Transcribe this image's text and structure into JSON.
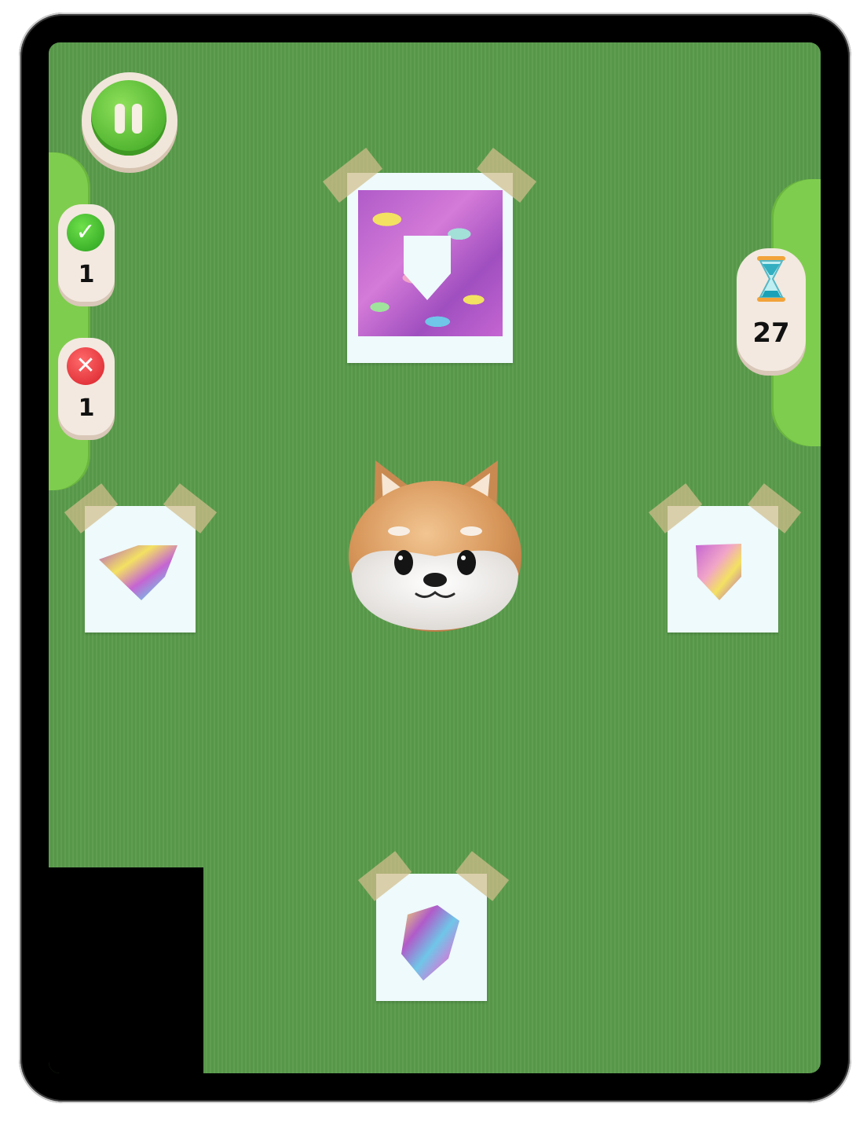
{
  "hud": {
    "correct_count": "1",
    "wrong_count": "1",
    "timer_value": "27"
  },
  "icons": {
    "pause": "pause-icon",
    "correct": "check-icon",
    "wrong": "x-icon",
    "timer": "hourglass-icon"
  },
  "colors": {
    "board": "#5a9c4c",
    "side_panel": "#7fcd4e",
    "pill": "#f3e9e0",
    "correct": "#28a01e",
    "wrong": "#d8202a",
    "card": "#eefafb"
  },
  "symbols": {
    "check": "✓",
    "cross": "✕"
  }
}
